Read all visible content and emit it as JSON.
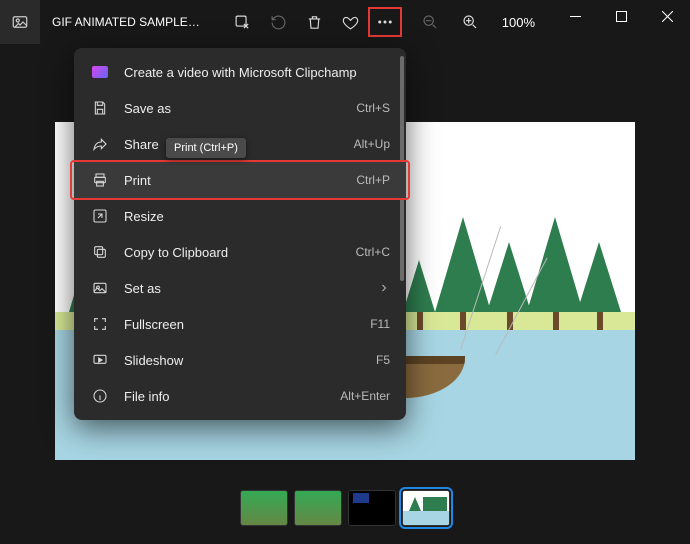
{
  "title": "GIF ANIMATED SAMPLE1 -...",
  "zoom": "100%",
  "tooltip": "Print (Ctrl+P)",
  "menu": {
    "items": [
      {
        "label": "Create a video with Microsoft Clipchamp",
        "accel": ""
      },
      {
        "label": "Save as",
        "accel": "Ctrl+S"
      },
      {
        "label": "Share",
        "accel": "Alt+Up"
      },
      {
        "label": "Print",
        "accel": "Ctrl+P"
      },
      {
        "label": "Resize",
        "accel": ""
      },
      {
        "label": "Copy to Clipboard",
        "accel": "Ctrl+C"
      },
      {
        "label": "Set as",
        "accel": ""
      },
      {
        "label": "Fullscreen",
        "accel": "F11"
      },
      {
        "label": "Slideshow",
        "accel": "F5"
      },
      {
        "label": "File info",
        "accel": "Alt+Enter"
      }
    ]
  }
}
